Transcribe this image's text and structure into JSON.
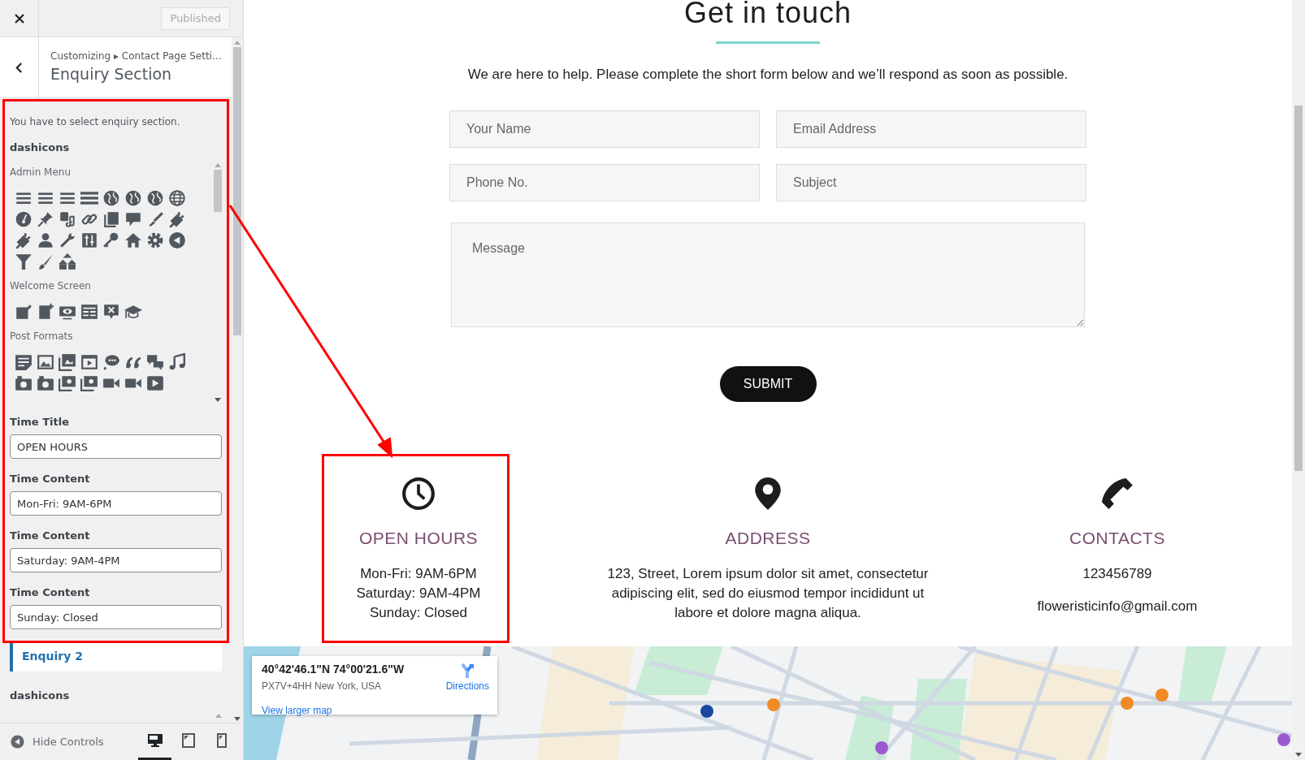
{
  "topbar": {
    "publish_button": {
      "label": "Published",
      "disabled": true
    }
  },
  "header": {
    "breadcrumb": "Customizing ▸ Contact Page Setti…",
    "title": "Enquiry Section"
  },
  "section": {
    "description": "You have to select enquiry section.",
    "picker_label": "dashicons",
    "icon_groups": [
      {
        "label": "Admin Menu"
      },
      {
        "label": "Welcome Screen"
      },
      {
        "label": "Post Formats"
      }
    ],
    "fields": [
      {
        "label": "Time Title",
        "value": "OPEN HOURS"
      },
      {
        "label": "Time Content",
        "value": "Mon-Fri: 9AM-6PM"
      },
      {
        "label": "Time Content",
        "value": "Saturday: 9AM-4PM"
      },
      {
        "label": "Time Content",
        "value": "Sunday: Closed"
      }
    ]
  },
  "next_section": {
    "label": "Enquiry 2",
    "picker_label": "dashicons"
  },
  "footer": {
    "hide_controls": "Hide Controls",
    "devices": [
      {
        "kind": "desktop",
        "selected": true
      },
      {
        "kind": "tablet",
        "selected": false
      },
      {
        "kind": "mobile",
        "selected": false
      }
    ]
  },
  "main": {
    "heading": "Get in touch",
    "intro": "We are here to help. Please complete the short form below and we’ll respond as soon as possible.",
    "fields": [
      {
        "placeholder": "Your Name"
      },
      {
        "placeholder": "Email Address"
      },
      {
        "placeholder": "Phone No."
      },
      {
        "placeholder": "Subject"
      }
    ],
    "message_placeholder": "Message",
    "submit": "SUBMIT",
    "info": [
      {
        "kind": "clock",
        "title": "OPEN HOURS",
        "lines": [
          "Mon-Fri: 9AM-6PM",
          "Saturday: 9AM-4PM",
          "Sunday: Closed"
        ]
      },
      {
        "kind": "pin",
        "title": "ADDRESS",
        "lines": [
          "123, Street, Lorem ipsum dolor sit amet, consectetur adipiscing elit, sed do eiusmod tempor incididunt ut labore et dolore magna aliqua."
        ]
      },
      {
        "kind": "phone",
        "title": "CONTACTS",
        "lines": [
          "123456789",
          "floweristicinfo@gmail.com"
        ]
      }
    ],
    "map": {
      "coordinates": "40°42'46.1\"N 74°00'21.6\"W",
      "plus_code": "PX7V+4HH New York, USA",
      "directions": "Directions",
      "larger_map": "View larger map"
    }
  }
}
